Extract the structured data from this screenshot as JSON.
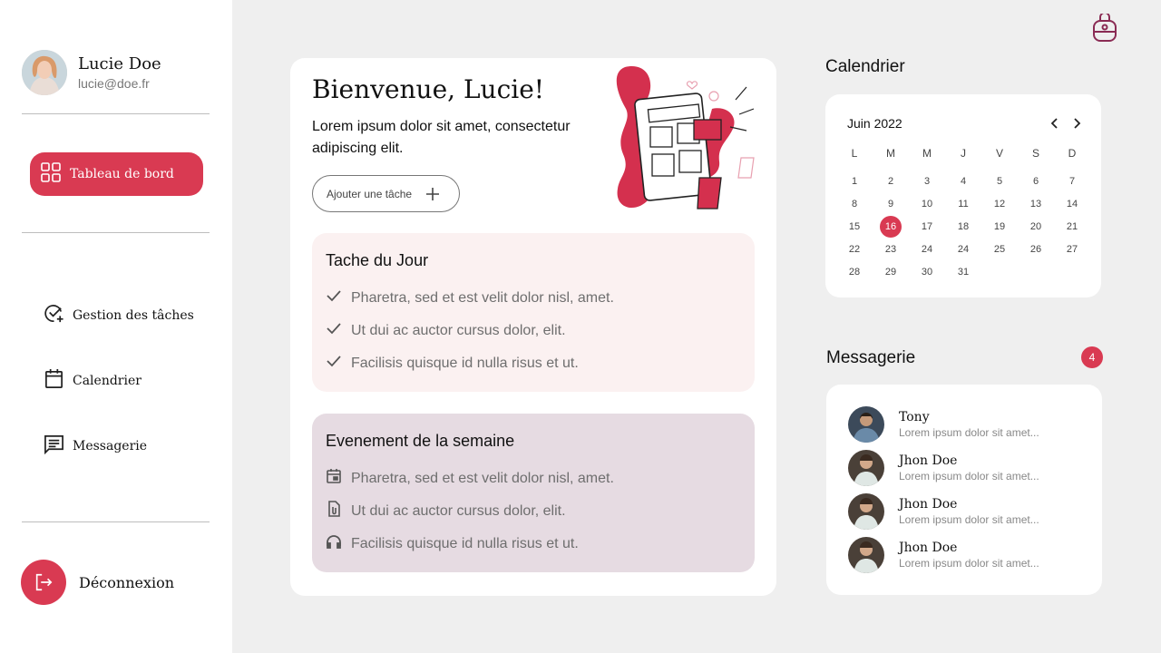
{
  "profile": {
    "name": "Lucie Doe",
    "email": "lucie@doe.fr"
  },
  "nav": {
    "dashboard": "Tableau de bord",
    "tasks": "Gestion des tâches",
    "calendar": "Calendrier",
    "messages": "Messagerie",
    "logout": "Déconnexion"
  },
  "welcome": {
    "title": "Bienvenue, Lucie!",
    "subtitle": "Lorem ipsum dolor sit amet, consectetur adipiscing elit.",
    "add_button": "Ajouter une tâche"
  },
  "tasks_panel": {
    "title": "Tache du Jour",
    "items": [
      "Pharetra, sed et est velit dolor nisl, amet.",
      "Ut dui ac auctor cursus dolor, elit.",
      "Facilisis quisque id nulla risus et ut."
    ]
  },
  "events_panel": {
    "title": "Evenement de la semaine",
    "items": [
      "Pharetra, sed et est velit dolor nisl, amet.",
      "Ut dui ac auctor cursus dolor, elit.",
      "Facilisis quisque id nulla risus et ut."
    ]
  },
  "calendar": {
    "heading": "Calendrier",
    "month": "Juin 2022",
    "weekdays": [
      "L",
      "M",
      "M",
      "J",
      "V",
      "S",
      "D"
    ],
    "weeks": [
      [
        "1",
        "2",
        "3",
        "4",
        "5",
        "6",
        "7"
      ],
      [
        "8",
        "9",
        "10",
        "11",
        "12",
        "13",
        "14"
      ],
      [
        "15",
        "16",
        "17",
        "18",
        "19",
        "20",
        "21"
      ],
      [
        "22",
        "23",
        "24",
        "24",
        "25",
        "26",
        "27"
      ],
      [
        "28",
        "29",
        "30",
        "31"
      ]
    ],
    "selected": "16"
  },
  "messages": {
    "heading": "Messagerie",
    "count": "4",
    "items": [
      {
        "name": "Tony",
        "preview": "Lorem ipsum dolor sit amet..."
      },
      {
        "name": "Jhon Doe",
        "preview": "Lorem ipsum dolor sit amet..."
      },
      {
        "name": "Jhon Doe",
        "preview": "Lorem ipsum dolor sit amet..."
      },
      {
        "name": "Jhon Doe",
        "preview": "Lorem ipsum dolor sit amet..."
      }
    ]
  },
  "colors": {
    "accent": "#d93a52",
    "tasks_bg": "#fbf1f1",
    "events_bg": "#e6dbe2",
    "page_bg": "#efefef"
  },
  "icons": {
    "dashboard": "grid-icon",
    "tasks": "check-circle-add-icon",
    "calendar": "calendar-icon",
    "messages": "message-icon",
    "logout": "logout-icon",
    "add": "plus-icon",
    "top": "backpack-icon"
  }
}
